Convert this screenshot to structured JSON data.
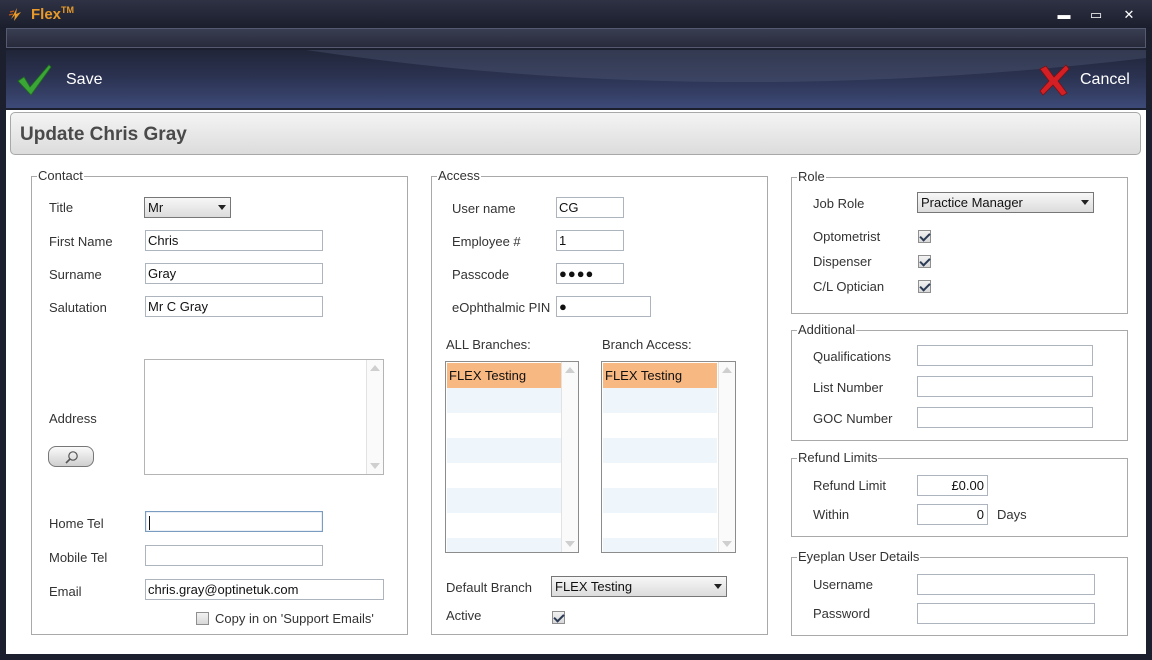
{
  "window": {
    "title": "Flex",
    "trademark": "TM",
    "minimize": "▬",
    "maximize": "▭",
    "close": "✕"
  },
  "toolbar": {
    "save_label": "Save",
    "cancel_label": "Cancel",
    "save_icon": "green-check-icon",
    "cancel_icon": "red-cross-icon"
  },
  "page": {
    "title": "Update Chris Gray"
  },
  "contact": {
    "legend": "Contact",
    "title_label": "Title",
    "title_value": "Mr",
    "first_name_label": "First Name",
    "first_name_value": "Chris",
    "surname_label": "Surname",
    "surname_value": "Gray",
    "salutation_label": "Salutation",
    "salutation_value": "Mr C Gray",
    "address_label": "Address",
    "address_value": "",
    "home_tel_label": "Home Tel",
    "home_tel_value": "",
    "mobile_tel_label": "Mobile Tel",
    "mobile_tel_value": "",
    "email_label": "Email",
    "email_value": "chris.gray@optinetuk.com",
    "copy_support_label": "Copy in on 'Support Emails'",
    "copy_support_checked": false
  },
  "access": {
    "legend": "Access",
    "username_label": "User name",
    "username_value": "CG",
    "employee_label": "Employee #",
    "employee_value": "1",
    "passcode_label": "Passcode",
    "passcode_value": "●●●●",
    "eophthalmic_label": "eOphthalmic PIN",
    "eophthalmic_value": "●",
    "all_branches_label": "ALL Branches:",
    "all_branches": [
      "FLEX Testing"
    ],
    "branch_access_label": "Branch Access:",
    "branch_access": [
      "FLEX Testing"
    ],
    "default_branch_label": "Default Branch",
    "default_branch_value": "FLEX Testing",
    "active_label": "Active",
    "active_checked": true
  },
  "role": {
    "legend": "Role",
    "job_role_label": "Job Role",
    "job_role_value": "Practice Manager",
    "optometrist_label": "Optometrist",
    "optometrist_checked": true,
    "dispenser_label": "Dispenser",
    "dispenser_checked": true,
    "cl_optician_label": "C/L Optician",
    "cl_optician_checked": true
  },
  "additional": {
    "legend": "Additional",
    "qualifications_label": "Qualifications",
    "qualifications_value": "",
    "list_number_label": "List Number",
    "list_number_value": "",
    "goc_number_label": "GOC Number",
    "goc_number_value": ""
  },
  "refund": {
    "legend": "Refund Limits",
    "refund_limit_label": "Refund Limit",
    "refund_limit_value": "£0.00",
    "within_label": "Within",
    "within_value": "0",
    "days_label": "Days"
  },
  "eyeplan": {
    "legend": "Eyeplan User Details",
    "username_label": "Username",
    "username_value": "",
    "password_label": "Password",
    "password_value": ""
  },
  "colors": {
    "accent_orange": "#e79a2a",
    "selection": "#f8b882",
    "toolbar_dark": "#202538"
  }
}
